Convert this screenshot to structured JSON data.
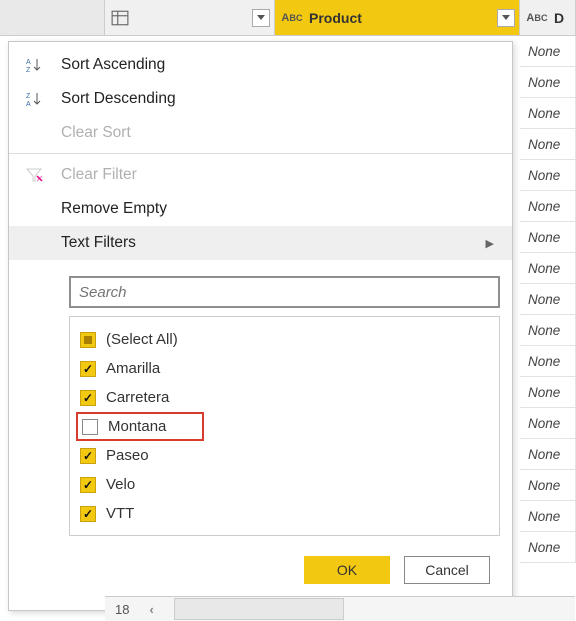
{
  "columns": {
    "col2_label": "Product",
    "col3_label": "D"
  },
  "menu": {
    "sort_asc": "Sort Ascending",
    "sort_desc": "Sort Descending",
    "clear_sort": "Clear Sort",
    "clear_filter": "Clear Filter",
    "remove_empty": "Remove Empty",
    "text_filters": "Text Filters"
  },
  "search": {
    "placeholder": "Search"
  },
  "checklist": {
    "select_all": "(Select All)",
    "items": [
      {
        "label": "Amarilla",
        "checked": true
      },
      {
        "label": "Carretera",
        "checked": true
      },
      {
        "label": "Montana",
        "checked": false,
        "highlight": true
      },
      {
        "label": "Paseo",
        "checked": true
      },
      {
        "label": "Velo",
        "checked": true
      },
      {
        "label": "VTT",
        "checked": true
      }
    ]
  },
  "buttons": {
    "ok": "OK",
    "cancel": "Cancel"
  },
  "cell_value": "None",
  "footer_num": "18"
}
